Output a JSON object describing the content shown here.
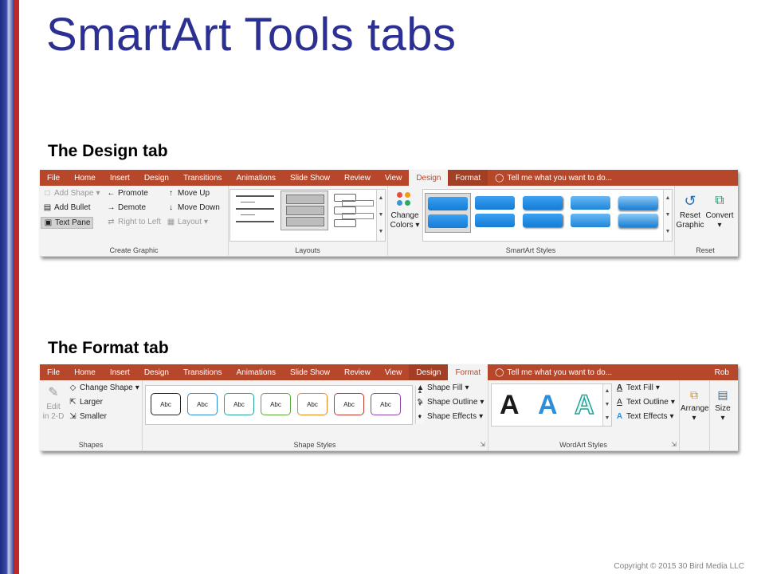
{
  "title": "SmartArt Tools tabs",
  "design_label": "The Design tab",
  "format_label": "The Format tab",
  "copyright": "Copyright © 2015 30 Bird Media LLC",
  "design_ribbon": {
    "tabs": [
      "File",
      "Home",
      "Insert",
      "Design",
      "Transitions",
      "Animations",
      "Slide Show",
      "Review",
      "View",
      "Design",
      "Format"
    ],
    "tell_me": "Tell me what you want to do...",
    "create_graphic": {
      "add_shape": "Add Shape",
      "add_bullet": "Add Bullet",
      "text_pane": "Text Pane",
      "promote": "Promote",
      "demote": "Demote",
      "right_to_left": "Right to Left",
      "move_up": "Move Up",
      "move_down": "Move Down",
      "layout": "Layout",
      "label": "Create Graphic"
    },
    "layouts_label": "Layouts",
    "change_colors_1": "Change",
    "change_colors_2": "Colors",
    "styles_label": "SmartArt Styles",
    "reset_graphic_1": "Reset",
    "reset_graphic_2": "Graphic",
    "convert": "Convert",
    "reset_label": "Reset"
  },
  "format_ribbon": {
    "tabs": [
      "File",
      "Home",
      "Insert",
      "Design",
      "Transitions",
      "Animations",
      "Slide Show",
      "Review",
      "View",
      "Design",
      "Format"
    ],
    "tell_me": "Tell me what you want to do...",
    "user": "Rob",
    "shapes": {
      "edit_1": "Edit",
      "edit_2": "in 2-D",
      "change_shape": "Change Shape",
      "larger": "Larger",
      "smaller": "Smaller",
      "label": "Shapes"
    },
    "shape_styles": {
      "abc": "Abc",
      "shape_fill": "Shape Fill",
      "shape_outline": "Shape Outline",
      "shape_effects": "Shape Effects",
      "label": "Shape Styles",
      "colors": [
        "#222222",
        "#2e8fd8",
        "#27a39b",
        "#5aa838",
        "#e58a1f",
        "#c0392b",
        "#8e44ad"
      ]
    },
    "wordart": {
      "letter": "A",
      "text_fill": "Text Fill",
      "text_outline": "Text Outline",
      "text_effects": "Text Effects",
      "label": "WordArt Styles"
    },
    "arrange": "Arrange",
    "size": "Size"
  }
}
